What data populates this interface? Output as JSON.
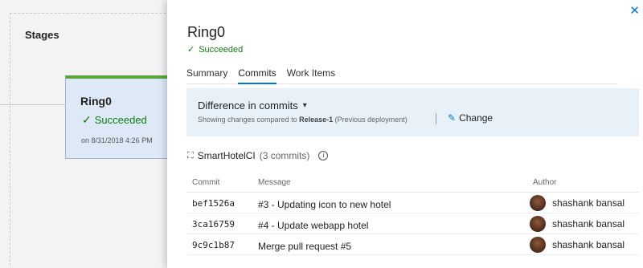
{
  "stages": {
    "title": "Stages",
    "card": {
      "name": "Ring0",
      "status": "Succeeded",
      "date": "on 8/31/2018 4:26 PM"
    }
  },
  "panel": {
    "title": "Ring0",
    "status": "Succeeded",
    "tabs": [
      {
        "label": "Summary",
        "active": false
      },
      {
        "label": "Commits",
        "active": true
      },
      {
        "label": "Work Items",
        "active": false
      }
    ],
    "diff": {
      "title": "Difference in commits",
      "sub_prefix": "Showing changes compared to",
      "release": "Release-1",
      "sub_suffix": "(Previous deployment)",
      "change_label": "Change"
    },
    "repo": {
      "name": "SmartHotelCI",
      "count": "(3 commits)"
    },
    "table": {
      "headers": {
        "commit": "Commit",
        "message": "Message",
        "author": "Author"
      },
      "rows": [
        {
          "hash": "bef1526a",
          "message": "#3 - Updating icon to new hotel",
          "author": "shashank bansal"
        },
        {
          "hash": "3ca16759",
          "message": "#4 - Update webapp hotel",
          "author": "shashank bansal"
        },
        {
          "hash": "9c9c1b87",
          "message": "Merge pull request #5",
          "author": "shashank bansal"
        }
      ]
    }
  },
  "colors": {
    "accent": "#0078d4",
    "success": "#107c10",
    "stage_bar": "#59a33a"
  }
}
